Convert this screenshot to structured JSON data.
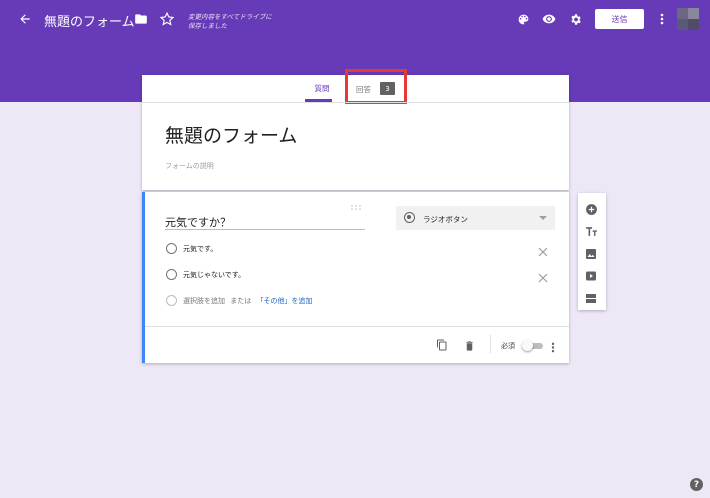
{
  "header": {
    "form_title": "無題のフォーム",
    "save_status_line1": "変更内容をすべてドライブに",
    "save_status_line2": "保存しました",
    "send_label": "送信"
  },
  "tabs": {
    "questions_label": "質問",
    "responses_label": "回答",
    "responses_count": "3"
  },
  "form": {
    "title": "無題のフォーム",
    "description_placeholder": "フォームの説明"
  },
  "question": {
    "title": "元気ですか？",
    "type_label": "ラジオボタン",
    "options": [
      "元気です。",
      "元気じゃないです。"
    ],
    "add_option_label": "選択肢を追加",
    "or_label": "または",
    "add_other_label": "「その他」を追加",
    "required_label": "必須"
  },
  "colors": {
    "accent": "#673ab7",
    "highlight": "#e53935",
    "link": "#1565c0"
  }
}
